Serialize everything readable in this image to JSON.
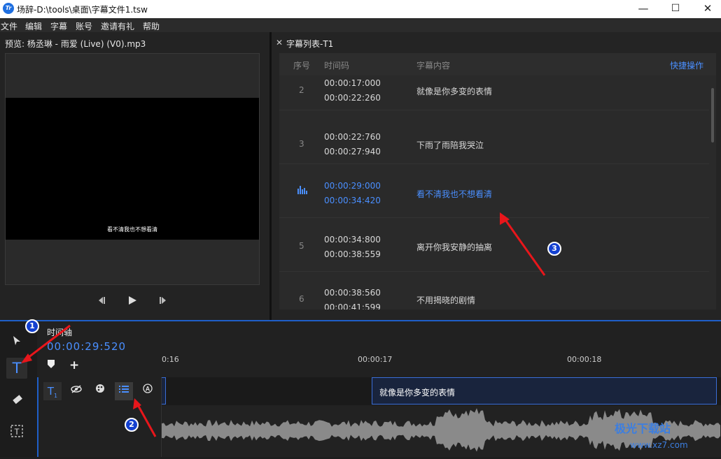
{
  "window": {
    "title": "场辞-D:\\tools\\桌面\\字幕文件1.tsw",
    "logo_text": "Tr",
    "minimize": "—",
    "maximize": "☐",
    "close": "✕"
  },
  "menu": [
    "文件",
    "编辑",
    "字幕",
    "账号",
    "邀请有礼",
    "帮助"
  ],
  "preview": {
    "title": "预览: 杨丞琳 - 雨爱 (Live) (V0).mp3",
    "subtitle_overlay": "看不清我也不想看清"
  },
  "subtitle_list": {
    "close": "✕",
    "title": "字幕列表-T1",
    "headers": {
      "index": "序号",
      "timecode": "时间码",
      "content": "字幕内容",
      "quick": "快捷操作"
    },
    "rows": [
      {
        "index": "2",
        "start": "00:00:17:000",
        "end": "00:00:22:260",
        "text": "就像是你多变的表情",
        "active": false
      },
      {
        "index": "3",
        "start": "00:00:22:760",
        "end": "00:00:27:940",
        "text": "下雨了雨陪我哭泣",
        "active": false
      },
      {
        "index": "",
        "start": "00:00:29:000",
        "end": "00:00:34:420",
        "text": "看不清我也不想看清",
        "active": true
      },
      {
        "index": "5",
        "start": "00:00:34:800",
        "end": "00:00:38:559",
        "text": "离开你我安静的抽离",
        "active": false
      },
      {
        "index": "6",
        "start": "00:00:38:560",
        "end": "00:00:41:599",
        "text": "不用揭晓的剧情",
        "active": false
      }
    ]
  },
  "timeline": {
    "label": "时间轴",
    "current_time": "00:00:29:520",
    "ticks": [
      "0:16",
      "00:00:17",
      "00:00:18"
    ],
    "clip_text": "就像是你多变的表情"
  },
  "annotations": [
    "1",
    "2",
    "3"
  ],
  "watermark": {
    "text": "极光下载站",
    "url": "www.xz7.com"
  },
  "colors": {
    "accent": "#4a8fff",
    "badge": "#1340d0",
    "arrow": "#e8161b"
  }
}
